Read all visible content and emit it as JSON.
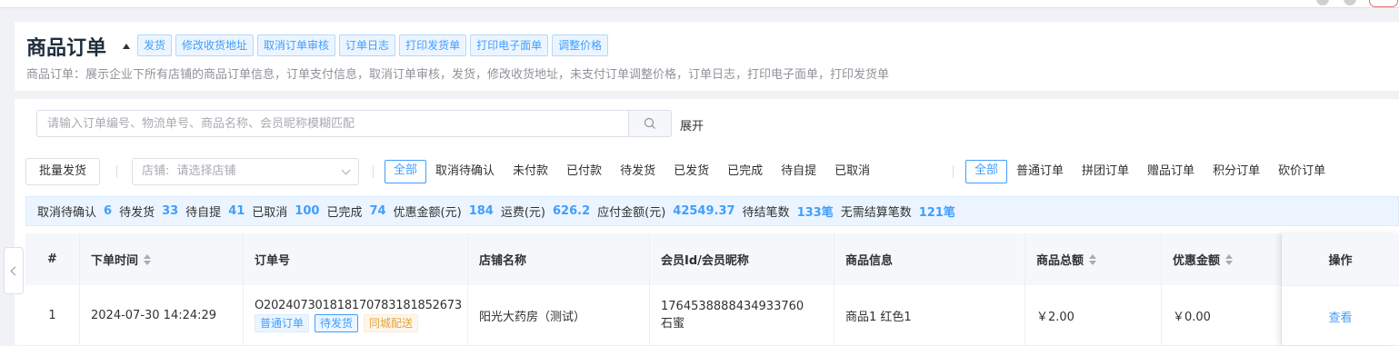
{
  "header": {
    "title": "商品订单",
    "buttons": [
      "发货",
      "修改收货地址",
      "取消订单审核",
      "订单日志",
      "打印发货单",
      "打印电子面单",
      "调整价格"
    ],
    "description": "商品订单：展示企业下所有店铺的商品订单信息，订单支付信息，取消订单审核，发货，修改收货地址，未支付订单调整价格，订单日志，打印电子面单，打印发货单"
  },
  "search": {
    "placeholder": "请输入订单编号、物流单号、商品名称、会员昵称模糊匹配",
    "expand_label": "展开"
  },
  "filters": {
    "bulk_ship": "批量发货",
    "shop_label": "店铺:",
    "shop_placeholder": "请选择店铺",
    "status_tabs": [
      "全部",
      "取消待确认",
      "未付款",
      "已付款",
      "待发货",
      "已发货",
      "已完成",
      "待自提",
      "已取消"
    ],
    "type_tabs": [
      "全部",
      "普通订单",
      "拼团订单",
      "赠品订单",
      "积分订单",
      "砍价订单"
    ]
  },
  "stats": [
    {
      "label": "取消待确认",
      "value": "6"
    },
    {
      "label": "待发货",
      "value": "33"
    },
    {
      "label": "待自提",
      "value": "41"
    },
    {
      "label": "已取消",
      "value": "100"
    },
    {
      "label": "已完成",
      "value": "74"
    },
    {
      "label": "优惠金额(元)",
      "value": "184"
    },
    {
      "label": "运费(元)",
      "value": "626.2"
    },
    {
      "label": "应付金额(元)",
      "value": "42549.37"
    },
    {
      "label": "待结笔数",
      "value": "133笔"
    },
    {
      "label": "无需结算笔数",
      "value": "121笔"
    }
  ],
  "table": {
    "columns": [
      "#",
      "下单时间",
      "订单号",
      "店铺名称",
      "会员Id/会员昵称",
      "商品信息",
      "商品总额",
      "优惠金额",
      "操作"
    ],
    "rows": [
      {
        "index": "1",
        "time": "2024-07-30 14:24:29",
        "order_no": "O20240730181817078318185 2673",
        "tags": [
          "普通订单",
          "待发货",
          "同城配送"
        ],
        "shop": "阳光大药房（测试）",
        "member_id": "1764538888434933760",
        "member_name": "石蜜",
        "goods": "商品1 红色1",
        "total": "￥2.00",
        "discount": "￥0.00",
        "action": "查看"
      }
    ]
  },
  "colors": {
    "accent": "#409eff",
    "warn": "#e6a23c"
  }
}
